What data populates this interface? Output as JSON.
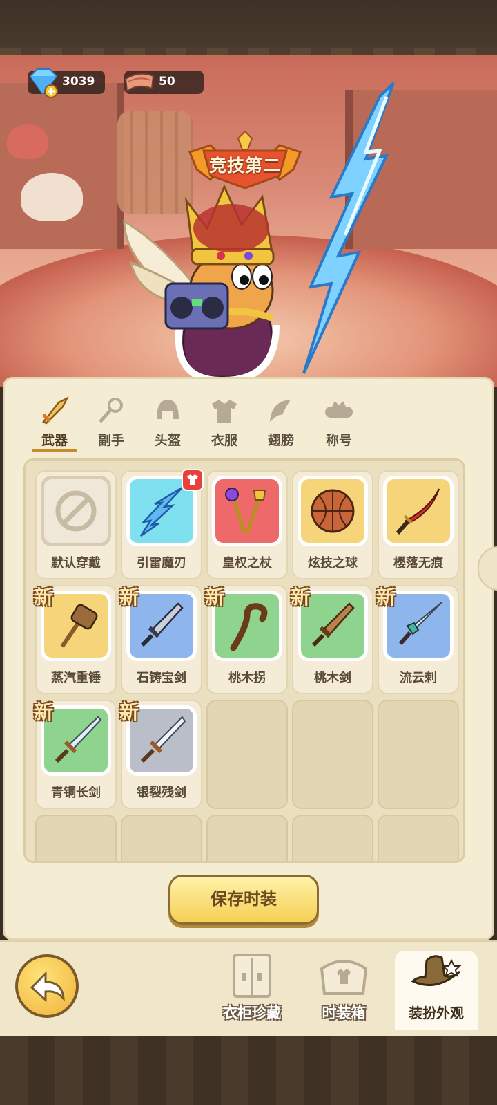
{
  "currency": {
    "diamonds": "3039",
    "tickets": "50"
  },
  "character": {
    "rank_badge": "竞技第二"
  },
  "tabs": [
    {
      "label": "武器",
      "active": true
    },
    {
      "label": "副手",
      "active": false
    },
    {
      "label": "头盔",
      "active": false
    },
    {
      "label": "衣服",
      "active": false
    },
    {
      "label": "翅膀",
      "active": false
    },
    {
      "label": "称号",
      "active": false
    }
  ],
  "items": [
    {
      "name": "默认穿戴",
      "rarity": "default",
      "new": false,
      "tag": ""
    },
    {
      "name": "引雷魔刃",
      "rarity": "cyan",
      "new": false,
      "tag": "equipped"
    },
    {
      "name": "皇权之杖",
      "rarity": "red",
      "new": false,
      "tag": ""
    },
    {
      "name": "炫技之球",
      "rarity": "gold",
      "new": false,
      "tag": ""
    },
    {
      "name": "樱落无痕",
      "rarity": "gold",
      "new": false,
      "tag": ""
    },
    {
      "name": "蒸汽重锤",
      "rarity": "gold",
      "new": true,
      "tag": "新"
    },
    {
      "name": "石铸宝剑",
      "rarity": "blue",
      "new": true,
      "tag": "新"
    },
    {
      "name": "桃木拐",
      "rarity": "green",
      "new": true,
      "tag": "新"
    },
    {
      "name": "桃木剑",
      "rarity": "green",
      "new": true,
      "tag": "新"
    },
    {
      "name": "流云刺",
      "rarity": "blue",
      "new": true,
      "tag": "新"
    },
    {
      "name": "青铜长剑",
      "rarity": "green",
      "new": true,
      "tag": "新"
    },
    {
      "name": "银裂残剑",
      "rarity": "gray",
      "new": true,
      "tag": "新"
    }
  ],
  "save_button": "保存时装",
  "bottom_nav": [
    {
      "label": "衣柜珍藏",
      "icon": "wardrobe-icon",
      "active": false
    },
    {
      "label": "时装箱",
      "icon": "fashion-chest-icon",
      "active": false
    },
    {
      "label": "装扮外观",
      "icon": "hat-icon",
      "active": true
    }
  ],
  "colors": {
    "cyan": "#7fe1f0",
    "red": "#ee6a6a",
    "gold": "#f6d57a",
    "blue": "#8fb6ec",
    "green": "#8fd48e",
    "gray": "#b9bec8",
    "default": "#efe8d8",
    "accent": "#c98a2c"
  }
}
